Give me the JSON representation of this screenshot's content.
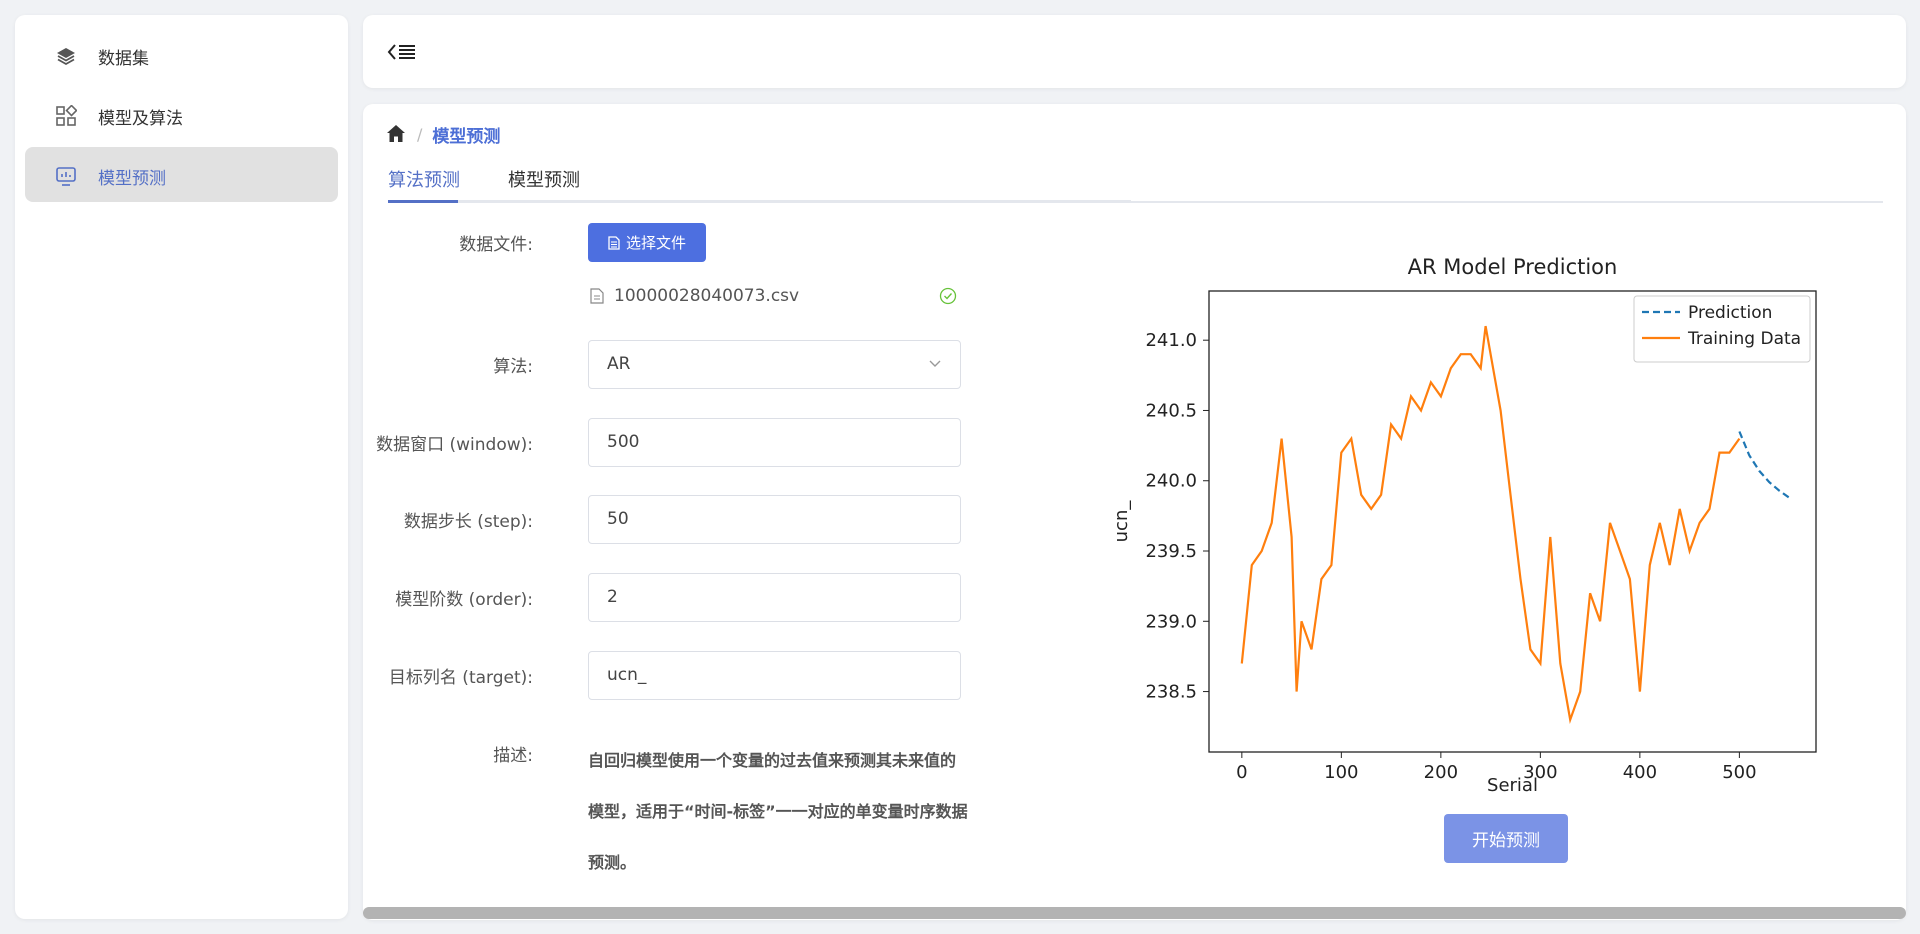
{
  "sidebar": {
    "items": [
      {
        "label": "数据集",
        "icon": "layers-icon"
      },
      {
        "label": "模型及算法",
        "icon": "grid-icon"
      },
      {
        "label": "模型预测",
        "icon": "monitor-chart-icon",
        "active": true
      }
    ]
  },
  "header": {
    "collapse_icon": "menu-collapse-icon"
  },
  "breadcrumb": {
    "home_icon": "home-icon",
    "separator": "/",
    "current": "模型预测"
  },
  "tabs": [
    {
      "label": "算法预测",
      "active": true
    },
    {
      "label": "模型预测",
      "active": false
    }
  ],
  "form": {
    "file_label": "数据文件:",
    "upload_button": "选择文件",
    "file_name": "10000028040073.csv",
    "algorithm_label": "算法:",
    "algorithm_value": "AR",
    "window_label": "数据窗口 (window):",
    "window_value": "500",
    "step_label": "数据步长 (step):",
    "step_value": "50",
    "order_label": "模型阶数 (order):",
    "order_value": "2",
    "target_label": "目标列名 (target):",
    "target_value": "ucn_",
    "desc_label": "描述:",
    "desc_text": "自回归模型使用一个变量的过去值来预测其未来值的模型，适用于“时间-标签”一一对应的单变量时序数据预测。"
  },
  "start_button": "开始预测",
  "colors": {
    "accent": "#5470c6",
    "primary_button": "#4d6fe0",
    "training": "#ff7f0e",
    "prediction": "#1f77b4"
  },
  "chart_data": {
    "type": "line",
    "title": "AR Model Prediction",
    "xlabel": "Serial",
    "ylabel": "ucn_",
    "xlim": [
      -33,
      577
    ],
    "ylim": [
      238.07,
      241.35
    ],
    "xticks": [
      0,
      100,
      200,
      300,
      400,
      500
    ],
    "yticks": [
      238.5,
      239.0,
      239.5,
      240.0,
      240.5,
      241.0
    ],
    "legend_position": "top-right",
    "series": [
      {
        "name": "Training Data",
        "style": "solid",
        "x": [
          0,
          10,
          20,
          30,
          40,
          50,
          55,
          60,
          70,
          80,
          90,
          100,
          110,
          120,
          130,
          140,
          150,
          160,
          170,
          180,
          190,
          200,
          210,
          220,
          230,
          240,
          245,
          250,
          260,
          270,
          280,
          290,
          300,
          310,
          320,
          330,
          340,
          350,
          360,
          370,
          380,
          390,
          400,
          410,
          420,
          430,
          440,
          450,
          460,
          470,
          480,
          490,
          500
        ],
        "values": [
          238.7,
          239.4,
          239.5,
          239.7,
          240.3,
          239.6,
          238.5,
          239.0,
          238.8,
          239.3,
          239.4,
          240.2,
          240.3,
          239.9,
          239.8,
          239.9,
          240.4,
          240.3,
          240.6,
          240.5,
          240.7,
          240.6,
          240.8,
          240.9,
          240.9,
          240.8,
          241.1,
          240.9,
          240.5,
          239.9,
          239.3,
          238.8,
          238.7,
          239.6,
          238.7,
          238.3,
          238.5,
          239.2,
          239.0,
          239.7,
          239.5,
          239.3,
          238.5,
          239.4,
          239.7,
          239.4,
          239.8,
          239.5,
          239.7,
          239.8,
          240.2,
          240.2,
          240.3
        ]
      },
      {
        "name": "Prediction",
        "style": "dashed",
        "x": [
          500,
          510,
          520,
          530,
          540,
          550
        ],
        "values": [
          240.35,
          240.18,
          240.07,
          239.99,
          239.93,
          239.88
        ]
      }
    ]
  }
}
